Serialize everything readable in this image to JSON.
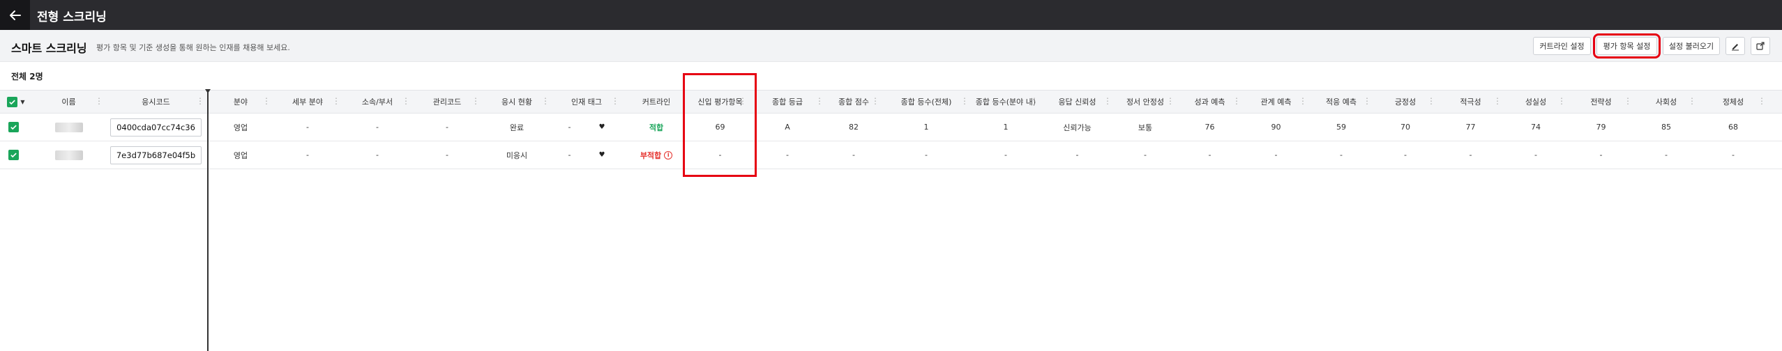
{
  "app": {
    "title": "전형 스크리닝"
  },
  "header": {
    "title": "스마트 스크리닝",
    "description": "평가 항목 및 기준 생성을 통해 원하는 인재를 채용해 보세요.",
    "buttons": {
      "career_line": "커트라인 설정",
      "eval_items": "평가 항목 설정",
      "load_settings": "설정 불러오기"
    }
  },
  "summary": {
    "total": "전체 2명"
  },
  "table": {
    "columns": [
      "이름",
      "응시코드",
      "분야",
      "세부 분야",
      "소속/부서",
      "관리코드",
      "응시 현황",
      "인재 태그",
      "커트라인",
      "신입 평가항목",
      "종합 등급",
      "종합 점수",
      "종합 등수(전체)",
      "종합 등수(분야 내)",
      "응답 신뢰성",
      "정서 안정성",
      "성과 예측",
      "관계 예측",
      "적응 예측",
      "긍정성",
      "적극성",
      "성실성",
      "전략성",
      "사회성",
      "정체성"
    ],
    "rows": [
      {
        "code": "0400cda07cc74c36",
        "cells": [
          "영업",
          "-",
          "-",
          "-",
          "완료",
          "-",
          "적합",
          "69",
          "A",
          "82",
          "1",
          "1",
          "신뢰가능",
          "보통",
          "76",
          "90",
          "59",
          "70",
          "77",
          "74",
          "79",
          "85",
          "68"
        ]
      },
      {
        "code": "7e3d77b687e04f5b",
        "cells": [
          "영업",
          "-",
          "-",
          "-",
          "미응시",
          "-",
          "부적합",
          "-",
          "-",
          "-",
          "-",
          "-",
          "-",
          "-",
          "-",
          "-",
          "-",
          "-",
          "-",
          "-",
          "-",
          "-",
          "-"
        ]
      }
    ]
  },
  "colors": {
    "topbar": "#2b2b2f",
    "accent_green": "#1aa55a",
    "alert_red": "#e5322d",
    "highlight": "#e60012"
  }
}
